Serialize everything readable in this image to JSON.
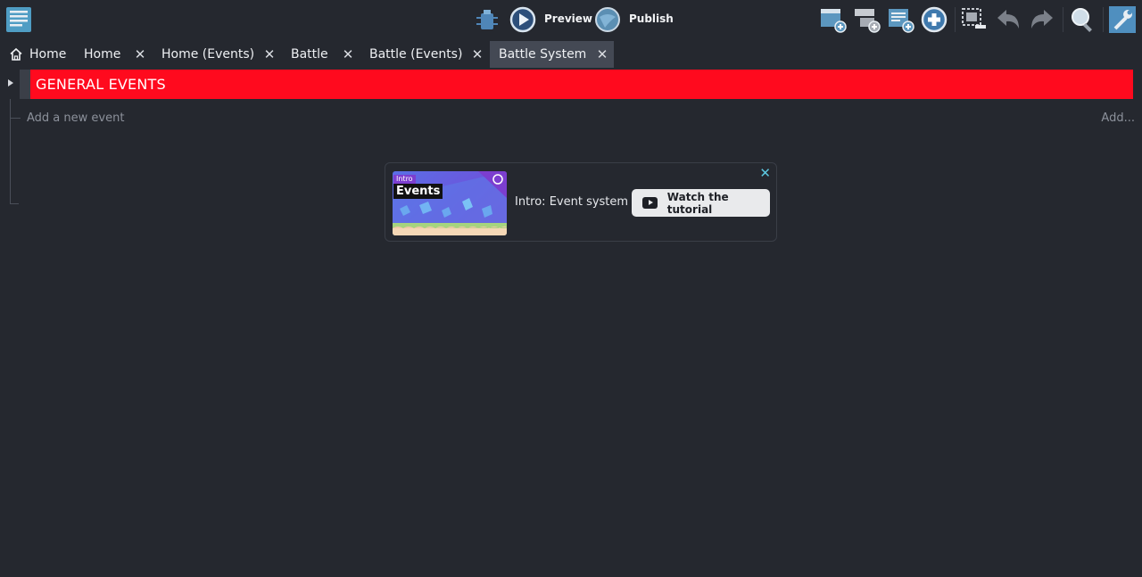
{
  "toolbar": {
    "preview_label": "Preview",
    "publish_label": "Publish",
    "icons": [
      "project-manager-icon",
      "debugger-icon",
      "preview-icon",
      "publish-icon",
      "add-event-icon",
      "add-sub-event-icon",
      "add-comment-icon",
      "add-other-icon",
      "delete-icon",
      "undo-icon",
      "redo-icon",
      "search-icon",
      "settings-icon"
    ]
  },
  "tabs": [
    {
      "label": "Home",
      "icon": "home-icon",
      "closable": false
    },
    {
      "label": "Home",
      "closable": true
    },
    {
      "label": "Home (Events)",
      "closable": true
    },
    {
      "label": "Battle",
      "closable": true
    },
    {
      "label": "Battle (Events)",
      "closable": true
    },
    {
      "label": "Battle System",
      "closable": true,
      "active": true
    }
  ],
  "events": {
    "group_title": "GENERAL EVENTS",
    "group_color": "#ff0a1e",
    "add_event_label": "Add a new event",
    "add_more_label": "Add..."
  },
  "tutorial": {
    "thumb_badge": "Intro",
    "thumb_title": "Events",
    "title": "Intro: Event system",
    "button_label": "Watch the tutorial"
  }
}
